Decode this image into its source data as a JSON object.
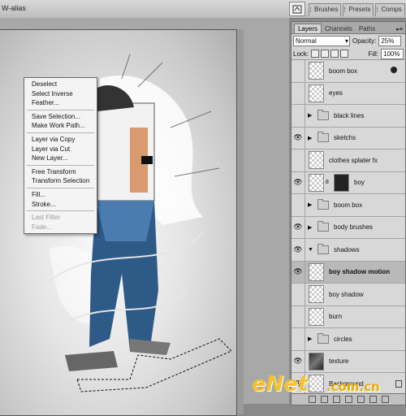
{
  "toolbar": {
    "alias_label": "W-alias"
  },
  "panel_wells": [
    "Brushes",
    "Presets",
    "Comps"
  ],
  "context_menu": {
    "groups": [
      [
        "Deselect",
        "Select Inverse",
        "Feather..."
      ],
      [
        "Save Selection...",
        "Make Work Path..."
      ],
      [
        "Layer via Copy",
        "Layer via Cut",
        "New Layer..."
      ],
      [
        "Free Transform",
        "Transform Selection"
      ],
      [
        "Fill...",
        "Stroke..."
      ],
      [
        "Last Filter",
        "Fade..."
      ]
    ],
    "disabled": [
      "Last Filter",
      "Fade..."
    ]
  },
  "layers_panel": {
    "tabs": [
      "Layers",
      "Channels",
      "Paths"
    ],
    "active_tab": "Layers",
    "blend_mode": "Normal",
    "opacity_label": "Opacity:",
    "opacity_value": "25%",
    "lock_label": "Lock:",
    "fill_label": "Fill:",
    "fill_value": "100%",
    "layers": [
      {
        "name": "boom box",
        "type": "layer",
        "visible": false
      },
      {
        "name": "eyes",
        "type": "layer",
        "visible": false
      },
      {
        "name": "black lines",
        "type": "group",
        "visible": false
      },
      {
        "name": "sketchs",
        "type": "group",
        "visible": true
      },
      {
        "name": "clothes splater fx",
        "type": "layer",
        "visible": false
      },
      {
        "name": "boy",
        "type": "masked",
        "visible": true
      },
      {
        "name": "boom box",
        "type": "group",
        "visible": false
      },
      {
        "name": "body brushes",
        "type": "group",
        "visible": true
      },
      {
        "name": "shadows",
        "type": "group-open",
        "visible": true
      },
      {
        "name": "boy shadow motion",
        "type": "layer",
        "visible": true,
        "selected": true
      },
      {
        "name": "boy shadow",
        "type": "layer",
        "visible": false
      },
      {
        "name": "burn",
        "type": "layer",
        "visible": false
      },
      {
        "name": "circles",
        "type": "group",
        "visible": false
      },
      {
        "name": "texture",
        "type": "texture",
        "visible": true
      },
      {
        "name": "Background",
        "type": "background",
        "visible": true
      }
    ]
  },
  "watermark": {
    "brand": "eNet",
    "site": ".com.cn"
  }
}
